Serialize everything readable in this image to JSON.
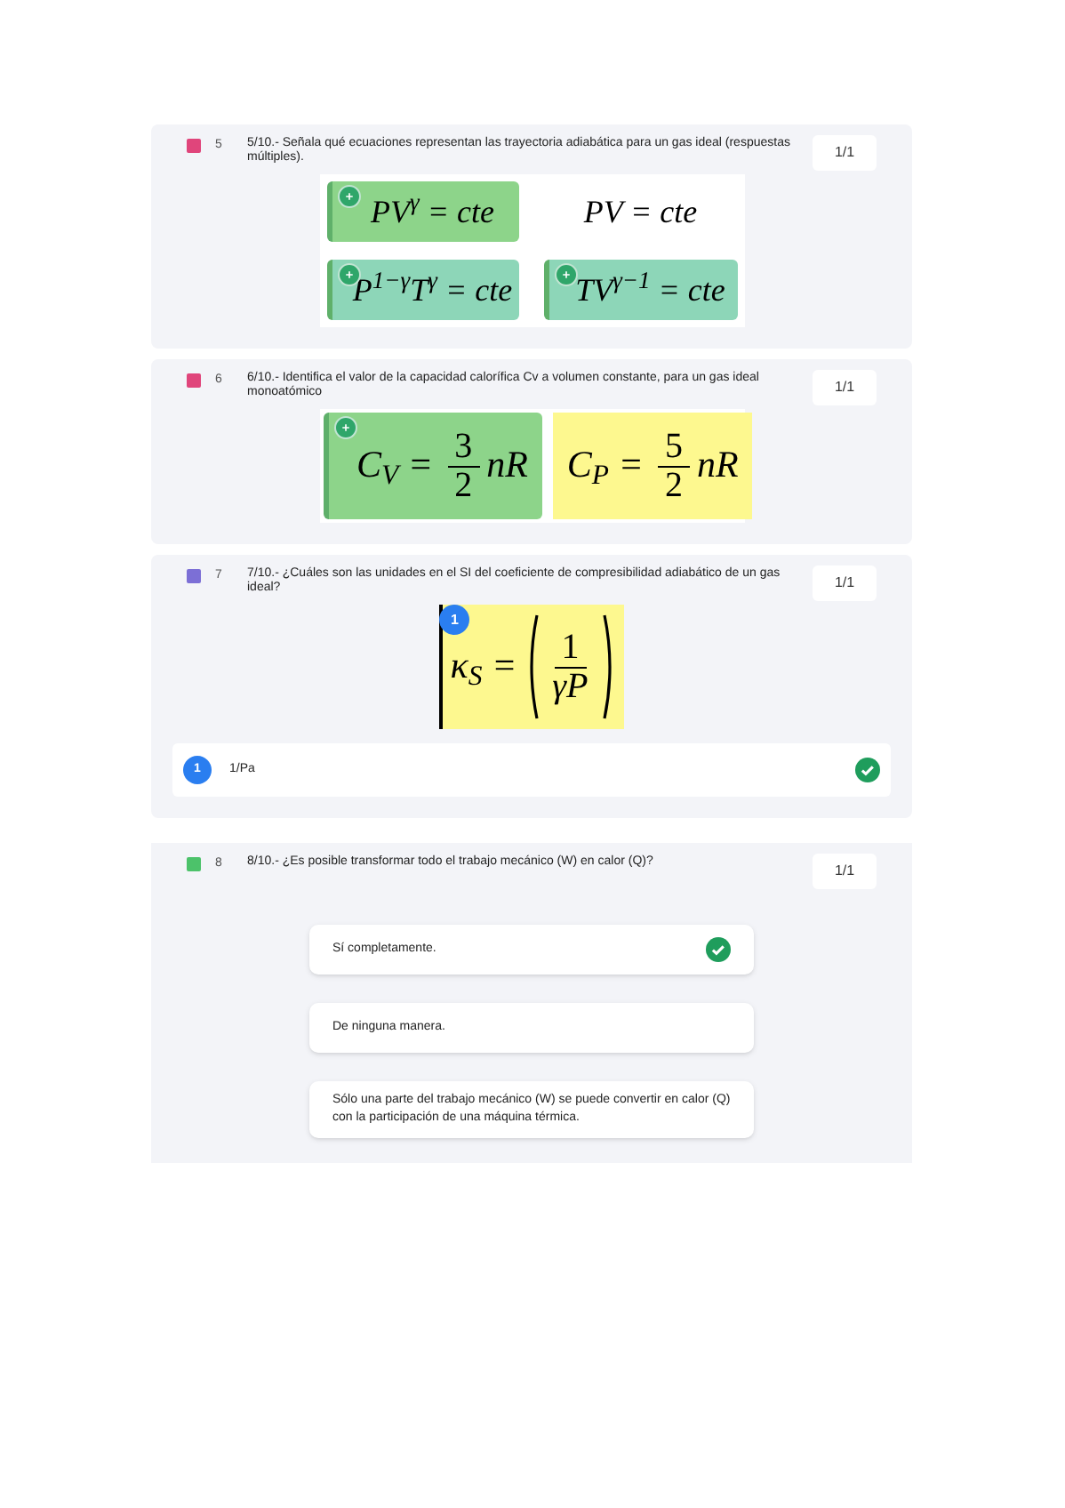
{
  "questions": [
    {
      "number": "5",
      "color": "#e0457b",
      "text": "5/10.- Señala qué ecuaciones representan las trayectoria adiabática para un gas ideal (respuestas múltiples).",
      "score": "1/1",
      "kind": "formula_grid",
      "options": [
        {
          "kind": "plain",
          "formula": "PV$^{γ}$ = cte",
          "selected": true,
          "color": "#8dd48a"
        },
        {
          "kind": "plain",
          "formula": "PV = cte",
          "selected": false
        },
        {
          "kind": "plain",
          "formula": "P$^{1−γ}$T$^{γ}$ = cte",
          "selected": true,
          "color": "#8dd6b8"
        },
        {
          "kind": "plain",
          "formula": "TV$^{γ−1}$ = cte",
          "selected": true,
          "color": "#8dd6b8"
        }
      ]
    },
    {
      "number": "6",
      "color": "#e0457b",
      "text": "6/10.- Identifica el valor de la capacidad calorífica Cv a volumen constante, para un gas ideal monoatómico",
      "score": "1/1",
      "kind": "formula_row",
      "options": [
        {
          "kind": "fraction",
          "lhs": "C$_{V}$ =",
          "numerator": "3",
          "denominator": "2",
          "rhs": "nR",
          "selected": true,
          "color": "#8dd48a"
        },
        {
          "kind": "fraction",
          "lhs": "C$_{P}$ =",
          "numerator": "5",
          "denominator": "2",
          "rhs": "nR",
          "selected": false,
          "color": "#fdf88f"
        }
      ]
    },
    {
      "number": "7",
      "color": "#7c6fd6",
      "text": "7/10.- ¿Cuáles son las unidades en el SI del coeficiente de compresibilidad adiabático de un gas ideal?",
      "score": "1/1",
      "kind": "formula_answer",
      "options": [
        {
          "kind": "paren_fraction",
          "lhs": "κ$_{S}$ =",
          "numerator": "1",
          "denominator": "γP",
          "selected": false,
          "color": "#fdf88f",
          "badge": "1"
        }
      ],
      "answer": {
        "badge": "1",
        "text": "1/Pa",
        "correct": true
      }
    },
    {
      "number": "8",
      "color": "#4cc26a",
      "text": "8/10.- ¿Es posible transformar todo el trabajo mecánico (W) en calor (Q)?",
      "score": "1/1",
      "kind": "choices",
      "choices": [
        {
          "text": "Sí completamente.",
          "correct": true
        },
        {
          "text": "De ninguna manera.",
          "correct": false
        },
        {
          "text": "Sólo una parte del trabajo mecánico (W) se puede convertir en calor (Q) con la participación de una máquina térmica.",
          "correct": false
        }
      ]
    }
  ]
}
